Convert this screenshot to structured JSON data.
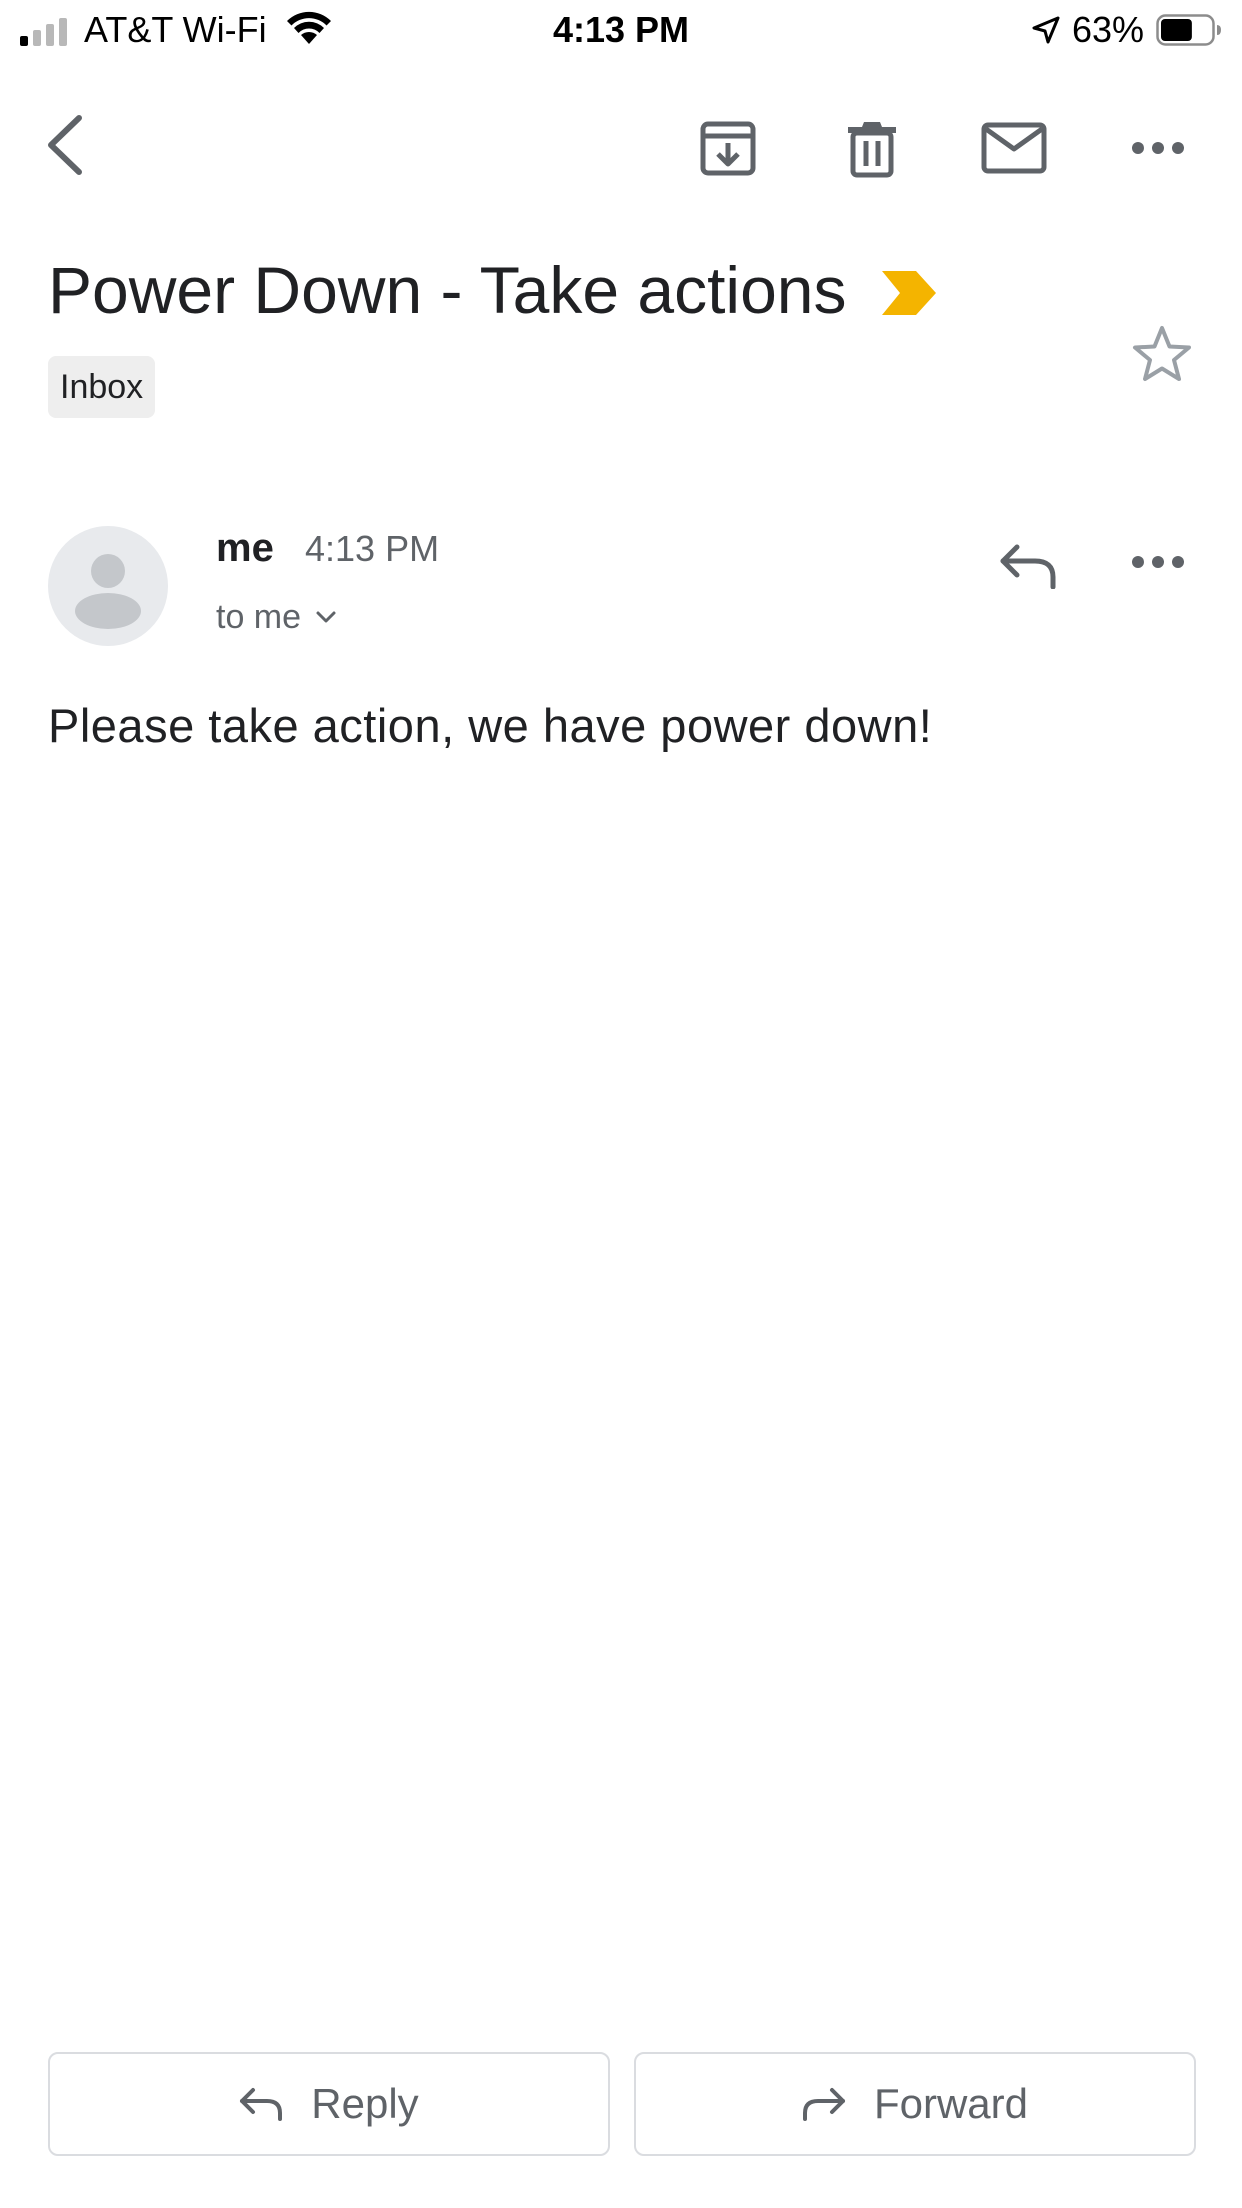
{
  "status_bar": {
    "carrier": "AT&T Wi-Fi",
    "time": "4:13 PM",
    "battery": "63%",
    "battery_level": 0.63,
    "signal_bars_filled": 1,
    "signal_bars_total": 4
  },
  "toolbar": {
    "icons": [
      "back-icon",
      "archive-icon",
      "trash-icon",
      "mail-icon",
      "more-icon"
    ]
  },
  "email": {
    "subject": "Power Down - Take actions",
    "label": "Inbox",
    "importance_color": "#f4b400",
    "sender": "me",
    "time": "4:13 PM",
    "recipients": "to me",
    "body": "Please take action, we have power down!"
  },
  "actions": {
    "reply": "Reply",
    "forward": "Forward"
  },
  "colors": {
    "icon": "#5f6368",
    "text": "#202124",
    "secondary_text": "#5f6368",
    "avatar_bg": "#e8eaed",
    "chip_bg": "#eeeeee",
    "button_border": "#dadce0"
  }
}
